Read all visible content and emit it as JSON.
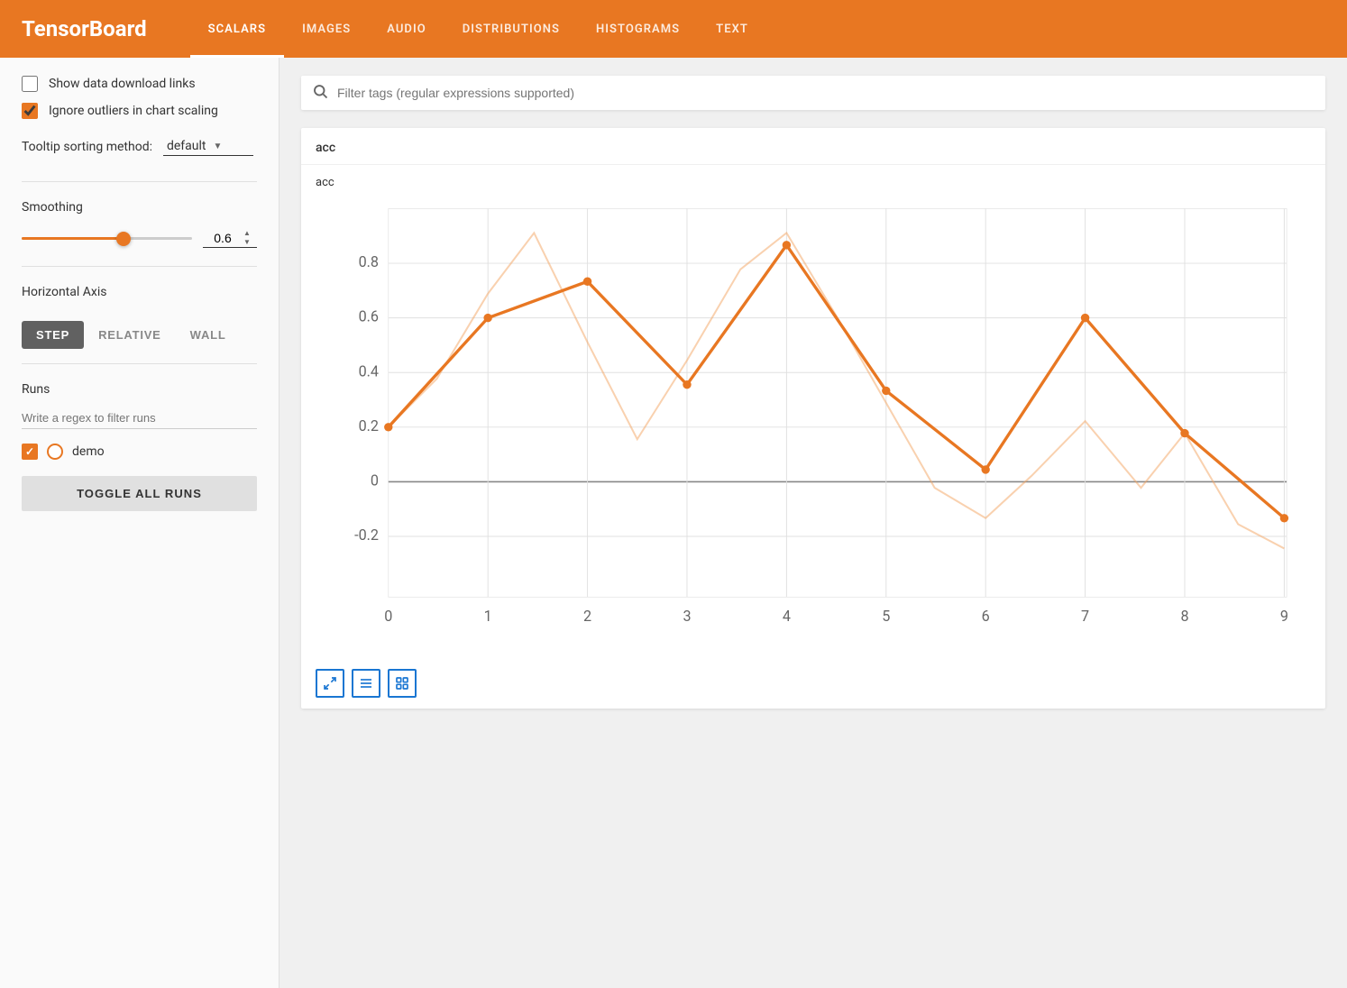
{
  "header": {
    "logo": "TensorBoard",
    "nav_items": [
      {
        "label": "SCALARS",
        "active": true
      },
      {
        "label": "IMAGES",
        "active": false
      },
      {
        "label": "AUDIO",
        "active": false
      },
      {
        "label": "DISTRIBUTIONS",
        "active": false
      },
      {
        "label": "HISTOGRAMS",
        "active": false
      },
      {
        "label": "TEXT",
        "active": false
      }
    ]
  },
  "sidebar": {
    "show_download_label": "Show data download links",
    "ignore_outliers_label": "Ignore outliers in chart scaling",
    "tooltip_label": "Tooltip sorting method:",
    "tooltip_value": "default",
    "smoothing_label": "Smoothing",
    "smoothing_value": "0.6",
    "smoothing_fill_pct": "60%",
    "smoothing_thumb_left": "calc(60% - 8px)",
    "horizontal_axis_label": "Horizontal Axis",
    "axis_buttons": [
      {
        "label": "STEP",
        "active": true
      },
      {
        "label": "RELATIVE",
        "active": false
      },
      {
        "label": "WALL",
        "active": false
      }
    ],
    "runs_label": "Runs",
    "runs_filter_placeholder": "Write a regex to filter runs",
    "run_items": [
      {
        "name": "demo",
        "checked": true
      }
    ],
    "toggle_all_label": "TOGGLE ALL RUNS"
  },
  "content": {
    "filter_placeholder": "Filter tags (regular expressions supported)",
    "chart_header_title": "acc",
    "chart_title": "acc",
    "chart_x_labels": [
      "0",
      "1",
      "2",
      "3",
      "4",
      "5",
      "6",
      "7",
      "8",
      "9"
    ],
    "chart_y_labels": [
      "0.8",
      "0.6",
      "0.4",
      "0.2",
      "0",
      "-0.2"
    ],
    "action_buttons": [
      {
        "name": "expand",
        "icon": "⛶"
      },
      {
        "name": "lines",
        "icon": "≡"
      },
      {
        "name": "zoom",
        "icon": "⊹"
      }
    ]
  }
}
